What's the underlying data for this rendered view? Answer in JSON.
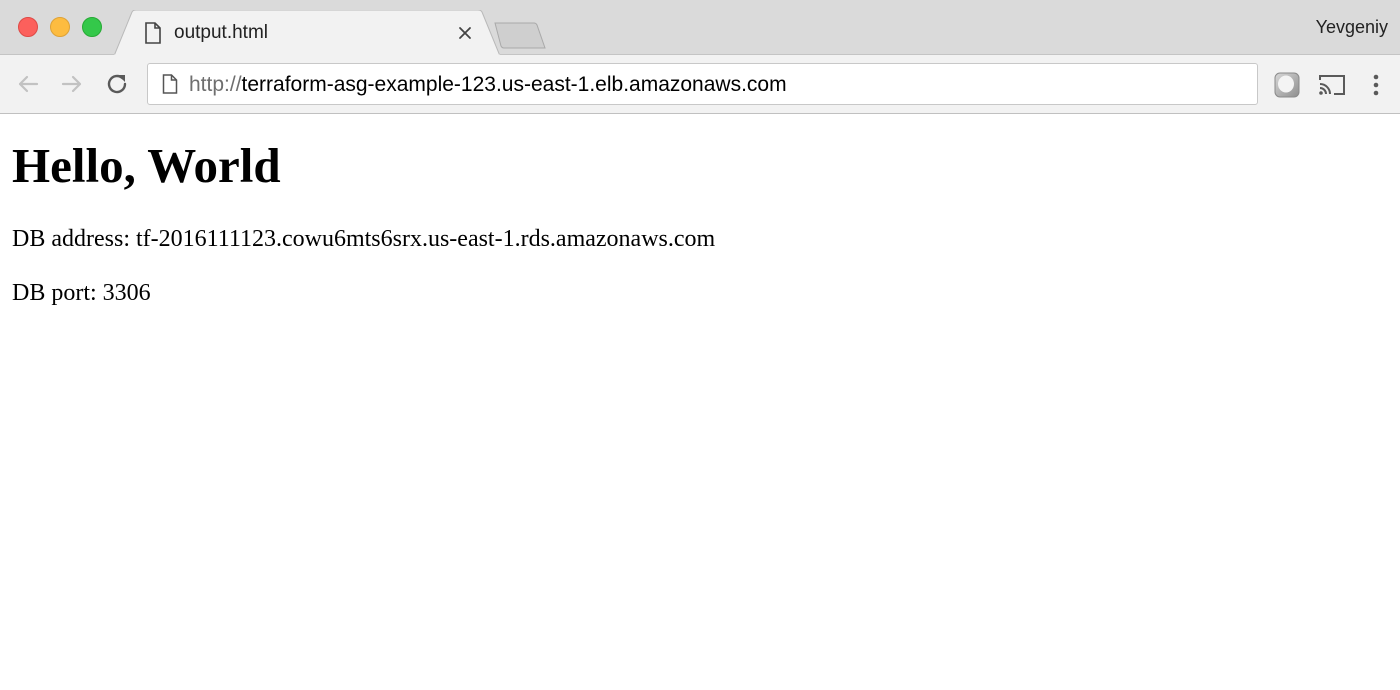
{
  "browser": {
    "tab": {
      "title": "output.html",
      "icon": "document-icon",
      "close_icon": "close-icon"
    },
    "new_tab_icon": "new-tab-icon",
    "profile_name": "Yevgeniy",
    "toolbar": {
      "back_icon": "arrow-left-icon",
      "forward_icon": "arrow-right-icon",
      "reload_icon": "reload-icon",
      "url_scheme": "http://",
      "url_host": "terraform-asg-example-123.us-east-1.elb.amazonaws.com",
      "extension_icon": "extension-icon",
      "cast_icon": "cast-icon",
      "menu_icon": "more-vert-icon"
    },
    "colors": {
      "close": "#fc605c",
      "minimize": "#fdbc40",
      "zoom": "#34c84a"
    }
  },
  "page": {
    "heading": "Hello, World",
    "db_address": "DB address: tf-2016111123.cowu6mts6srx.us-east-1.rds.amazonaws.com",
    "db_port": "DB port: 3306"
  }
}
